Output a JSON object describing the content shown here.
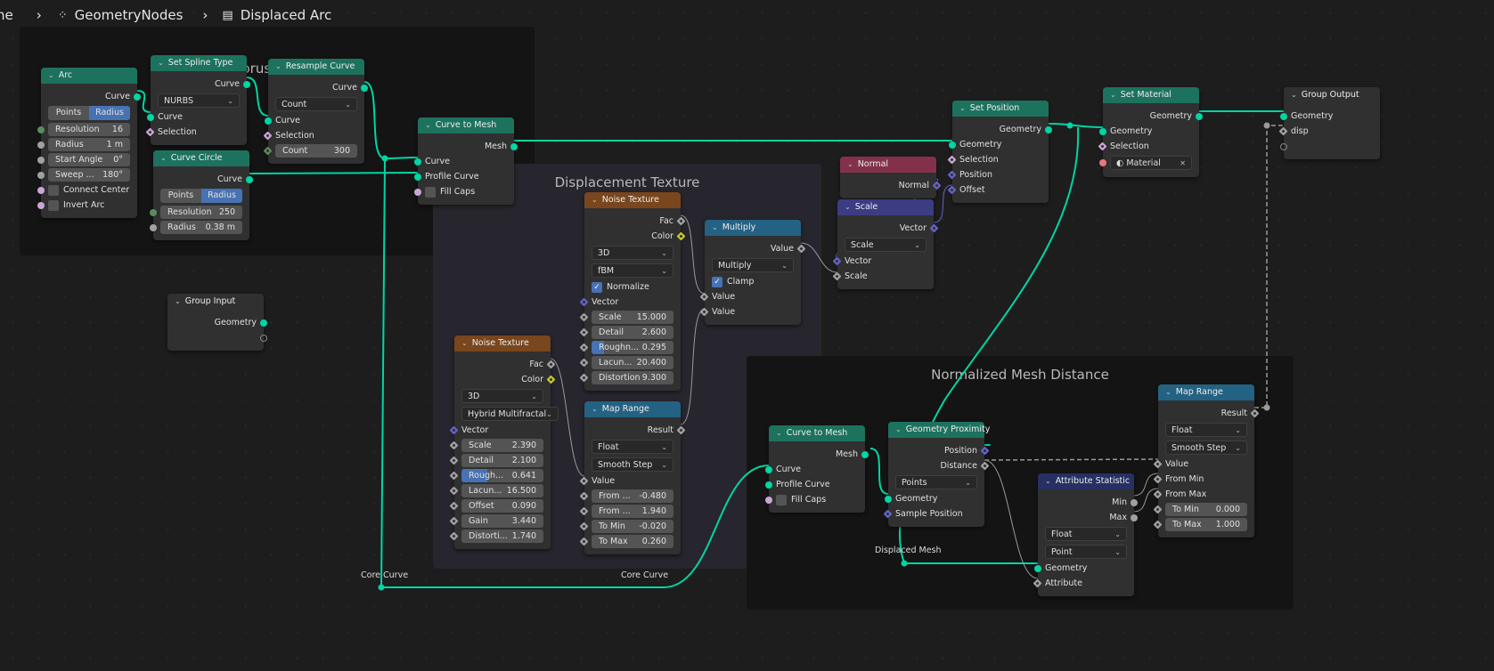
{
  "breadcrumb": {
    "items": [
      {
        "label": "ne",
        "icon": "scene-icon"
      },
      {
        "label": "GeometryNodes",
        "icon": "geometry-nodes-icon"
      },
      {
        "label": "Displaced Arc",
        "icon": "node-tree-icon"
      }
    ]
  },
  "colors": {
    "geometry": "#00d6a3",
    "float": "#a1a1a1",
    "int": "#598c5c",
    "bool": "#cca6d6",
    "vector": "#6363c7",
    "color": "#c7c729",
    "material": "#eb7582",
    "hdr_geometry": "#1d725e",
    "hdr_texture": "#79461d",
    "hdr_converter": "#246283",
    "hdr_input": "#83314a",
    "hdr_vector": "#3c3c83",
    "hdr_attribute": "#273063",
    "hdr_group": "#303030"
  },
  "frames": [
    {
      "title": "Torus Sector"
    },
    {
      "title": "Displacement Texture"
    },
    {
      "title": "Normalized  Mesh Distance"
    }
  ],
  "reroute_labels": [
    "Core Curve",
    "Core Curve",
    "Displaced Mesh"
  ],
  "nodes": [
    {
      "id": "arc",
      "title": "Arc",
      "kind": "hdr_geometry",
      "rows": [
        {
          "t": "out",
          "label": "Curve",
          "s": "geometry"
        },
        {
          "t": "tog",
          "options": [
            "Points",
            "Radius"
          ],
          "selected": 1
        },
        {
          "t": "fld",
          "label": "Resolution",
          "value": "16",
          "s": "int"
        },
        {
          "t": "fld",
          "label": "Radius",
          "value": "1 m",
          "s": "float"
        },
        {
          "t": "fld",
          "label": "Start Angle",
          "value": "0°",
          "s": "float"
        },
        {
          "t": "fld",
          "label": "Sweep ...",
          "value": "180°",
          "s": "float"
        },
        {
          "t": "cb",
          "label": "Connect Center",
          "checked": false,
          "s": "bool"
        },
        {
          "t": "cb",
          "label": "Invert Arc",
          "checked": false,
          "s": "bool"
        }
      ]
    },
    {
      "id": "spline",
      "title": "Set Spline Type",
      "kind": "hdr_geometry",
      "rows": [
        {
          "t": "out",
          "label": "Curve",
          "s": "geometry"
        },
        {
          "t": "dd",
          "value": "NURBS"
        },
        {
          "t": "in",
          "label": "Curve",
          "s": "geometry"
        },
        {
          "t": "in",
          "label": "Selection",
          "s": "bool",
          "field": true
        }
      ]
    },
    {
      "id": "resample",
      "title": "Resample Curve",
      "kind": "hdr_geometry",
      "rows": [
        {
          "t": "out",
          "label": "Curve",
          "s": "geometry"
        },
        {
          "t": "dd",
          "value": "Count"
        },
        {
          "t": "in",
          "label": "Curve",
          "s": "geometry"
        },
        {
          "t": "in",
          "label": "Selection",
          "s": "bool",
          "field": true
        },
        {
          "t": "fld",
          "label": "Count",
          "value": "300",
          "s": "int",
          "field": true
        }
      ]
    },
    {
      "id": "circle",
      "title": "Curve Circle",
      "kind": "hdr_geometry",
      "rows": [
        {
          "t": "out",
          "label": "Curve",
          "s": "geometry"
        },
        {
          "t": "tog",
          "options": [
            "Points",
            "Radius"
          ],
          "selected": 1
        },
        {
          "t": "fld",
          "label": "Resolution",
          "value": "250",
          "s": "int"
        },
        {
          "t": "fld",
          "label": "Radius",
          "value": "0.38 m",
          "s": "float"
        }
      ]
    },
    {
      "id": "c2m",
      "title": "Curve to Mesh",
      "kind": "hdr_geometry",
      "rows": [
        {
          "t": "out",
          "label": "Mesh",
          "s": "geometry"
        },
        {
          "t": "in",
          "label": "Curve",
          "s": "geometry"
        },
        {
          "t": "in",
          "label": "Profile Curve",
          "s": "geometry"
        },
        {
          "t": "cb",
          "label": "Fill Caps",
          "checked": false,
          "s": "bool"
        }
      ]
    },
    {
      "id": "gin",
      "title": "Group Input",
      "kind": "hdr_group",
      "rows": [
        {
          "t": "out",
          "label": "Geometry",
          "s": "geometry"
        },
        {
          "t": "out",
          "label": "",
          "s": "empty"
        }
      ]
    },
    {
      "id": "noise1",
      "title": "Noise Texture",
      "kind": "hdr_texture",
      "rows": [
        {
          "t": "out",
          "label": "Fac",
          "s": "float",
          "field": true
        },
        {
          "t": "out",
          "label": "Color",
          "s": "color",
          "field": true
        },
        {
          "t": "dd",
          "value": "3D"
        },
        {
          "t": "dd",
          "value": "fBM"
        },
        {
          "t": "cb",
          "label": "Normalize",
          "checked": true
        },
        {
          "t": "in",
          "label": "Vector",
          "s": "vector",
          "field": true
        },
        {
          "t": "fld",
          "label": "Scale",
          "value": "15.000",
          "s": "float",
          "field": true
        },
        {
          "t": "fld",
          "label": "Detail",
          "value": "2.600",
          "s": "float",
          "field": true
        },
        {
          "t": "fld",
          "label": "Roughn...",
          "value": "0.295",
          "fill": 0.295,
          "s": "float",
          "field": true
        },
        {
          "t": "fld",
          "label": "Lacun...",
          "value": "20.400",
          "s": "float",
          "field": true
        },
        {
          "t": "fld",
          "label": "Distortion",
          "value": "9.300",
          "s": "float",
          "field": true
        }
      ]
    },
    {
      "id": "mult",
      "title": "Multiply",
      "kind": "hdr_converter",
      "rows": [
        {
          "t": "out",
          "label": "Value",
          "s": "float",
          "field": true
        },
        {
          "t": "dd",
          "value": "Multiply"
        },
        {
          "t": "cb",
          "label": "Clamp",
          "checked": true
        },
        {
          "t": "in",
          "label": "Value",
          "s": "float",
          "field": true
        },
        {
          "t": "in",
          "label": "Value",
          "s": "float",
          "field": true
        }
      ]
    },
    {
      "id": "noise2",
      "title": "Noise Texture",
      "kind": "hdr_texture",
      "rows": [
        {
          "t": "out",
          "label": "Fac",
          "s": "float",
          "field": true
        },
        {
          "t": "out",
          "label": "Color",
          "s": "color",
          "field": true
        },
        {
          "t": "dd",
          "value": "3D"
        },
        {
          "t": "dd",
          "value": "Hybrid Multifractal"
        },
        {
          "t": "in",
          "label": "Vector",
          "s": "vector",
          "field": true
        },
        {
          "t": "fld",
          "label": "Scale",
          "value": "2.390",
          "s": "float",
          "field": true
        },
        {
          "t": "fld",
          "label": "Detail",
          "value": "2.100",
          "s": "float",
          "field": true
        },
        {
          "t": "fld",
          "label": "Rough...",
          "value": "0.641",
          "fill": 0.641,
          "s": "float",
          "field": true
        },
        {
          "t": "fld",
          "label": "Lacun...",
          "value": "16.500",
          "s": "float",
          "field": true
        },
        {
          "t": "fld",
          "label": "Offset",
          "value": "0.090",
          "s": "float",
          "field": true
        },
        {
          "t": "fld",
          "label": "Gain",
          "value": "3.440",
          "s": "float",
          "field": true
        },
        {
          "t": "fld",
          "label": "Distorti...",
          "value": "1.740",
          "s": "float",
          "field": true
        }
      ]
    },
    {
      "id": "maprange1",
      "title": "Map Range",
      "kind": "hdr_converter",
      "rows": [
        {
          "t": "out",
          "label": "Result",
          "s": "float",
          "field": true
        },
        {
          "t": "dd",
          "value": "Float"
        },
        {
          "t": "dd",
          "value": "Smooth Step"
        },
        {
          "t": "in",
          "label": "Value",
          "s": "float",
          "field": true
        },
        {
          "t": "fld",
          "label": "From ...",
          "value": "-0.480",
          "s": "float",
          "field": true
        },
        {
          "t": "fld",
          "label": "From ...",
          "value": "1.940",
          "s": "float",
          "field": true
        },
        {
          "t": "fld",
          "label": "To Min",
          "value": "-0.020",
          "s": "float",
          "field": true
        },
        {
          "t": "fld",
          "label": "To Max",
          "value": "0.260",
          "s": "float",
          "field": true
        }
      ]
    },
    {
      "id": "normal",
      "title": "Normal",
      "kind": "hdr_input",
      "rows": [
        {
          "t": "out",
          "label": "Normal",
          "s": "vector",
          "field": true
        }
      ]
    },
    {
      "id": "scale",
      "title": "Scale",
      "kind": "hdr_vector",
      "rows": [
        {
          "t": "out",
          "label": "Vector",
          "s": "vector",
          "field": true
        },
        {
          "t": "dd",
          "value": "Scale"
        },
        {
          "t": "in",
          "label": "Vector",
          "s": "vector",
          "field": true
        },
        {
          "t": "in",
          "label": "Scale",
          "s": "float",
          "field": true
        }
      ]
    },
    {
      "id": "setpos",
      "title": "Set Position",
      "kind": "hdr_geometry",
      "rows": [
        {
          "t": "out",
          "label": "Geometry",
          "s": "geometry"
        },
        {
          "t": "in",
          "label": "Geometry",
          "s": "geometry"
        },
        {
          "t": "in",
          "label": "Selection",
          "s": "bool",
          "field": true
        },
        {
          "t": "in",
          "label": "Position",
          "s": "vector",
          "field": true
        },
        {
          "t": "in",
          "label": "Offset",
          "s": "vector",
          "field": true
        }
      ]
    },
    {
      "id": "setmat",
      "title": "Set Material",
      "kind": "hdr_geometry",
      "rows": [
        {
          "t": "out",
          "label": "Geometry",
          "s": "geometry"
        },
        {
          "t": "in",
          "label": "Geometry",
          "s": "geometry"
        },
        {
          "t": "in",
          "label": "Selection",
          "s": "bool",
          "field": true
        },
        {
          "t": "mat",
          "label": "Material",
          "s": "material"
        }
      ]
    },
    {
      "id": "gout",
      "title": "Group Output",
      "kind": "hdr_group",
      "rows": [
        {
          "t": "in",
          "label": "Geometry",
          "s": "geometry"
        },
        {
          "t": "in",
          "label": "disp",
          "s": "float",
          "field": true
        },
        {
          "t": "in",
          "label": "",
          "s": "empty"
        }
      ]
    },
    {
      "id": "c2m2",
      "title": "Curve to Mesh",
      "kind": "hdr_geometry",
      "rows": [
        {
          "t": "out",
          "label": "Mesh",
          "s": "geometry"
        },
        {
          "t": "in",
          "label": "Curve",
          "s": "geometry"
        },
        {
          "t": "in",
          "label": "Profile Curve",
          "s": "geometry"
        },
        {
          "t": "cb",
          "label": "Fill Caps",
          "checked": false,
          "s": "bool"
        }
      ]
    },
    {
      "id": "geoprox",
      "title": "Geometry Proximity",
      "kind": "hdr_geometry",
      "rows": [
        {
          "t": "out",
          "label": "Position",
          "s": "vector",
          "field": true
        },
        {
          "t": "out",
          "label": "Distance",
          "s": "float",
          "field": true
        },
        {
          "t": "dd",
          "value": "Points"
        },
        {
          "t": "in",
          "label": "Geometry",
          "s": "geometry"
        },
        {
          "t": "in",
          "label": "Sample Position",
          "s": "vector",
          "field": true
        }
      ]
    },
    {
      "id": "attrstat",
      "title": "Attribute Statistic",
      "kind": "hdr_attribute",
      "rows": [
        {
          "t": "out",
          "label": "Min",
          "s": "float"
        },
        {
          "t": "out",
          "label": "Max",
          "s": "float"
        },
        {
          "t": "dd",
          "value": "Float"
        },
        {
          "t": "dd",
          "value": "Point"
        },
        {
          "t": "in",
          "label": "Geometry",
          "s": "geometry"
        },
        {
          "t": "in",
          "label": "Attribute",
          "s": "float",
          "field": true
        }
      ]
    },
    {
      "id": "maprange2",
      "title": "Map Range",
      "kind": "hdr_converter",
      "rows": [
        {
          "t": "out",
          "label": "Result",
          "s": "float",
          "field": true
        },
        {
          "t": "dd",
          "value": "Float"
        },
        {
          "t": "dd",
          "value": "Smooth Step"
        },
        {
          "t": "in",
          "label": "Value",
          "s": "float",
          "field": true
        },
        {
          "t": "in",
          "label": "From Min",
          "s": "float",
          "field": true
        },
        {
          "t": "in",
          "label": "From Max",
          "s": "float",
          "field": true
        },
        {
          "t": "fld",
          "label": "To Min",
          "value": "0.000",
          "s": "float",
          "field": true
        },
        {
          "t": "fld",
          "label": "To Max",
          "value": "1.000",
          "s": "float",
          "field": true
        }
      ]
    }
  ]
}
